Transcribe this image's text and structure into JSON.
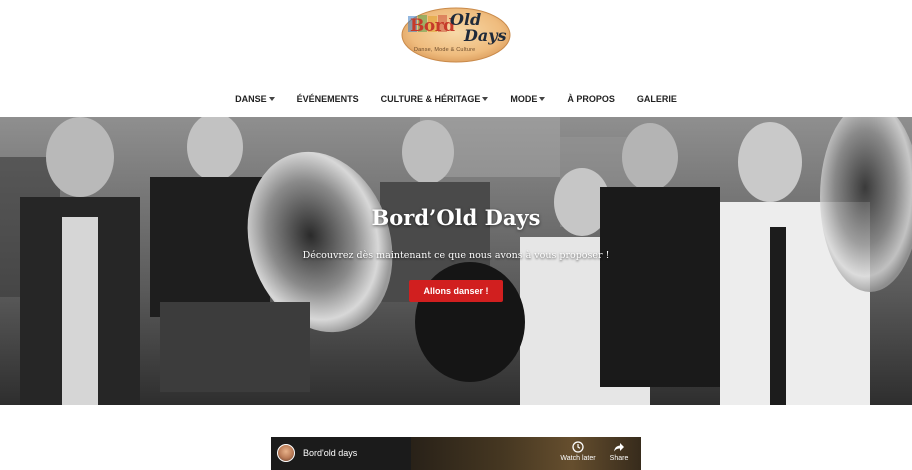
{
  "logo": {
    "word1": "Bord",
    "word2": "Old",
    "word3": "Days",
    "tagline": "Danse, Mode & Culture"
  },
  "nav": {
    "items": [
      {
        "label": "Danse",
        "dropdown": true
      },
      {
        "label": "Événements",
        "dropdown": false
      },
      {
        "label": "Culture & Héritage",
        "dropdown": true
      },
      {
        "label": "Mode",
        "dropdown": true
      },
      {
        "label": "À propos",
        "dropdown": false
      },
      {
        "label": "Galerie",
        "dropdown": false
      }
    ]
  },
  "hero": {
    "title": "Bord’Old Days",
    "subtitle": "Découvrez dès maintenant ce que nous avons à vous proposer !",
    "button_label": "Allons danser !",
    "button_color": "#d11f1f"
  },
  "video": {
    "channel_title": "Bord'old days",
    "watch_later_label": "Watch later",
    "share_label": "Share"
  }
}
